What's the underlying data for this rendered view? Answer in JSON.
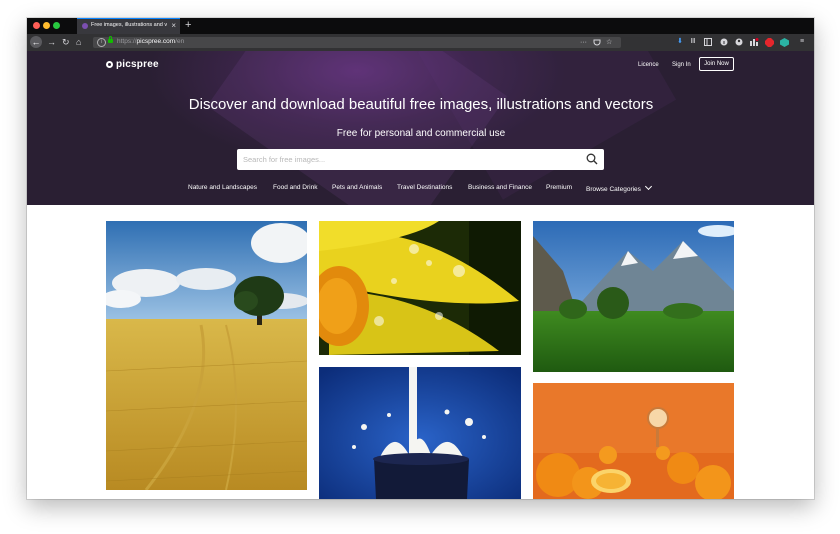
{
  "browser": {
    "tab_title": "Free images, illustrations and vectors",
    "tab_close": "×",
    "new_tab": "+",
    "url_scheme": "https://",
    "url_domain": "picspree.com",
    "url_path": "/en",
    "nav_back": "←",
    "nav_forward": "→",
    "nav_reload": "↻",
    "nav_home": "⌂",
    "page_actions": "···",
    "menu": "≡"
  },
  "site": {
    "logo": "picspree",
    "nav": {
      "licence": "Licence",
      "sign_in": "Sign In",
      "join_now": "Join Now"
    },
    "hero_title": "Discover and download beautiful free images, illustrations and vectors",
    "hero_subtitle": "Free for personal and commercial use",
    "search_placeholder": "Search for free images...",
    "categories": [
      "Nature and Landscapes",
      "Food and Drink",
      "Pets and Animals",
      "Travel Destinations",
      "Business and Finance",
      "Premium",
      "Browse Categories"
    ]
  },
  "colors": {
    "hero_bg": "#2a1f33",
    "hero_accent": "#5a2f72",
    "tab_accent": "#0a84ff"
  }
}
